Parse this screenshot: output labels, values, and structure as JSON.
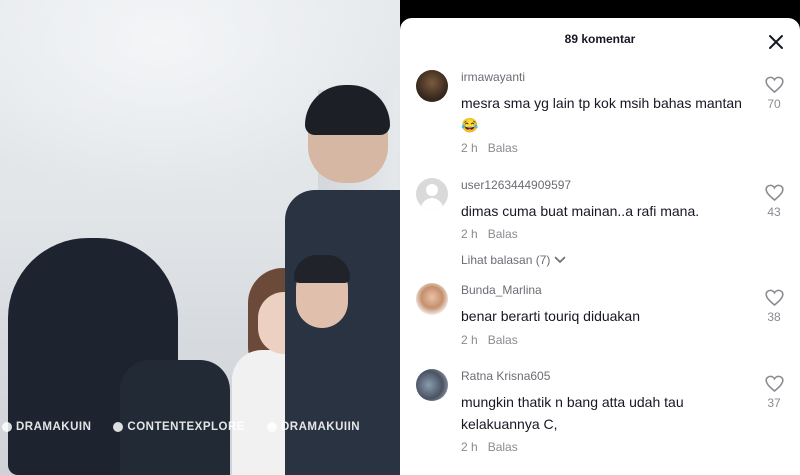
{
  "video": {
    "watermarks": [
      {
        "icon": "tiktok-icon",
        "text": "DRAMAKUIN"
      },
      {
        "icon": "instagram-icon",
        "text": "CONTENTEXPLORE"
      },
      {
        "icon": "tiktok-icon",
        "text": "DRAMAKUIIN"
      }
    ]
  },
  "panel": {
    "title": "89 komentar",
    "close_icon": "close-icon"
  },
  "comments": [
    {
      "username": "irmawayanti",
      "text": "mesra sma yg lain tp kok msih bahas mantan😂",
      "time": "2 h",
      "reply": "Balas",
      "likes": "70",
      "avatar": "photo"
    },
    {
      "username": "user1263444909597",
      "text": "dimas cuma buat mainan..a rafi mana.",
      "time": "2 h",
      "reply": "Balas",
      "likes": "43",
      "avatar": "default",
      "view_replies": "Lihat balasan (7)"
    },
    {
      "username": "Bunda_Marlina",
      "text": "benar berarti touriq diduakan",
      "time": "2 h",
      "reply": "Balas",
      "likes": "38",
      "avatar": "photo"
    },
    {
      "username": "Ratna Krisna605",
      "text": "mungkin thatik n bang atta udah tau kelakuannya C,",
      "time": "2 h",
      "reply": "Balas",
      "likes": "37",
      "avatar": "photo"
    }
  ],
  "colors": {
    "panel_bg": "#ffffff",
    "text_primary": "#161823",
    "text_secondary": "#8a8b91"
  }
}
